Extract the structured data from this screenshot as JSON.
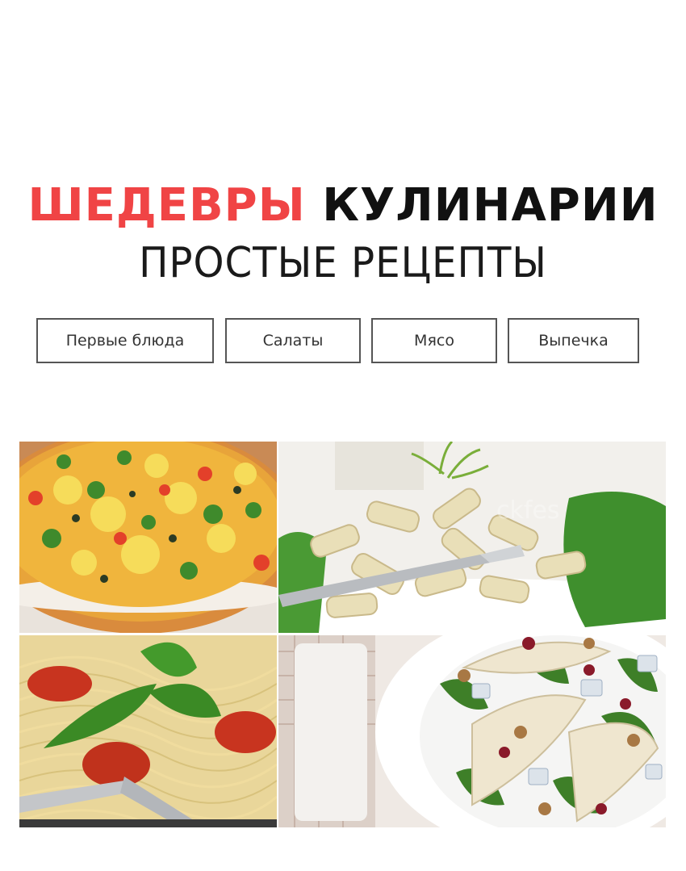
{
  "header": {
    "title_highlight": "ШЕДЕВРЫ",
    "title_rest": "КУЛИНАРИИ",
    "subtitle": "ПРОСТЫЕ РЕЦЕПТЫ"
  },
  "categories": [
    {
      "label": "Первые блюда"
    },
    {
      "label": "Салаты"
    },
    {
      "label": "Мясо"
    },
    {
      "label": "Выпечка"
    }
  ],
  "gallery": {
    "watermark": "ckfes"
  },
  "colors": {
    "accent": "#f04445",
    "text": "#111111",
    "button_border": "#555555"
  }
}
